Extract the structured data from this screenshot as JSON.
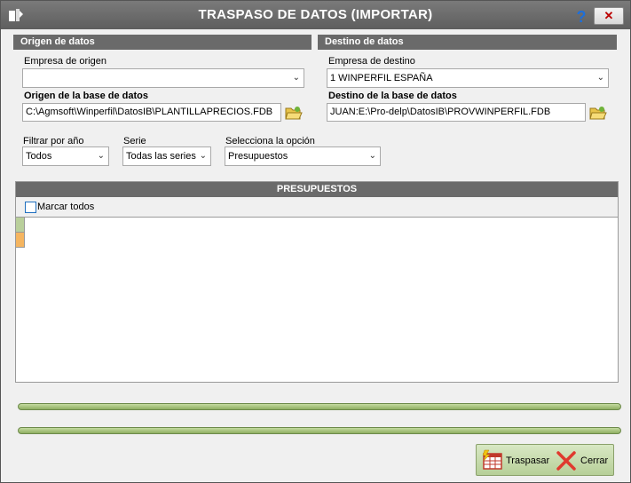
{
  "window": {
    "title": "TRASPASO DE DATOS (IMPORTAR)",
    "help": "?",
    "close": "✕"
  },
  "origen": {
    "header": "Origen de datos",
    "empresa_label": "Empresa de origen",
    "empresa_value": "",
    "bd_label": "Origen de la base de datos",
    "bd_value": "C:\\Agmsoft\\Winperfil\\DatosIB\\PLANTILLAPRECIOS.FDB"
  },
  "destino": {
    "header": "Destino de datos",
    "empresa_label": "Empresa de destino",
    "empresa_value": "1  WINPERFIL ESPAÑA",
    "bd_label": "Destino de la base de datos",
    "bd_value": "JUAN:E:\\Pro-delp\\DatosIB\\PROVWINPERFIL.FDB"
  },
  "filtros": {
    "anio_label": "Filtrar por año",
    "anio_value": "Todos",
    "serie_label": "Serie",
    "serie_value": "Todas las series",
    "opcion_label": "Selecciona la opción",
    "opcion_value": "Presupuestos"
  },
  "grid": {
    "header": "PRESUPUESTOS",
    "marcar_todos": "Marcar todos",
    "row_indicator_colors": [
      "#b9cf9b",
      "#f5b560"
    ]
  },
  "progress": {
    "bar1_percent": 100,
    "bar2_percent": 100
  },
  "buttons": {
    "traspasar": "Traspasar",
    "cerrar": "Cerrar"
  },
  "icons": [
    "app-icon",
    "help-icon",
    "close-icon",
    "folder-open-icon",
    "table-icon",
    "close-x-icon",
    "chevron-down-icon"
  ]
}
